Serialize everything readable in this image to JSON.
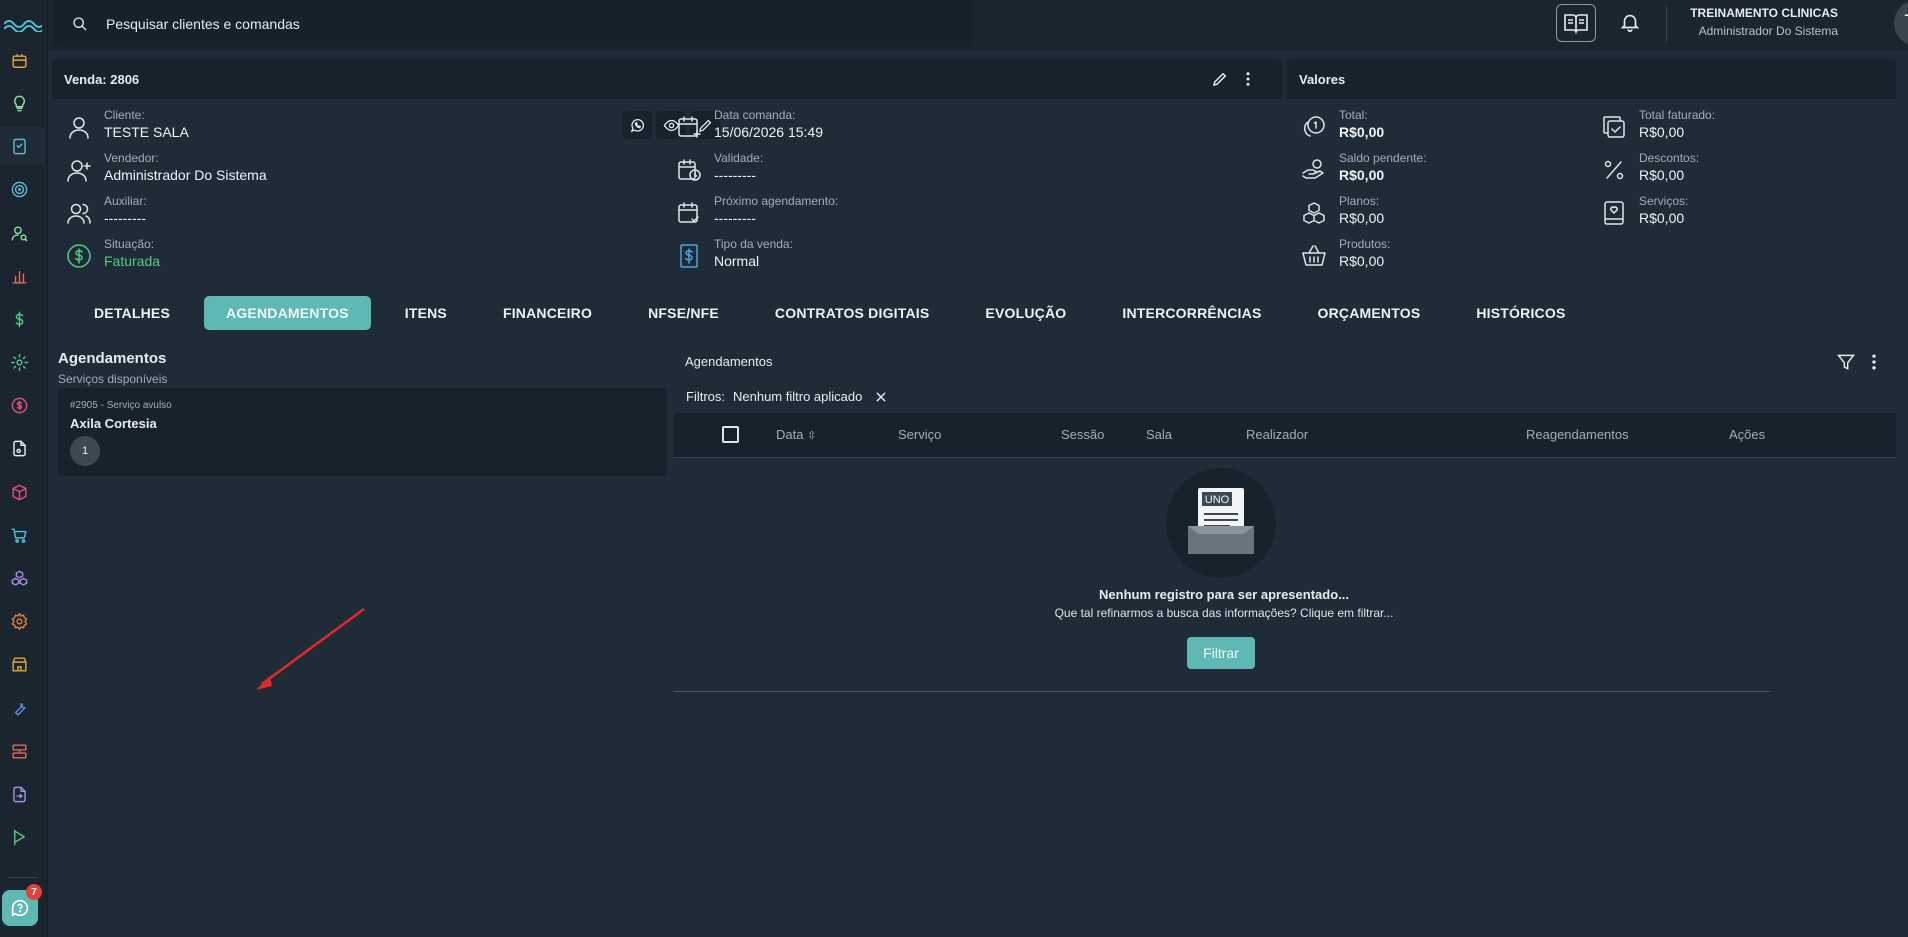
{
  "search": {
    "placeholder": "Pesquisar clientes e comandas"
  },
  "user": {
    "name": "TREINAMENTO CLINICAS",
    "role": "Administrador Do Sistema",
    "initials": "TC"
  },
  "help": {
    "badge": "7"
  },
  "venda": {
    "title": "Venda: 2806",
    "cliente_label": "Cliente:",
    "cliente": "TESTE SALA",
    "vendedor_label": "Vendedor:",
    "vendedor": "Administrador Do Sistema",
    "auxiliar_label": "Auxiliar:",
    "auxiliar": "---------",
    "situacao_label": "Situação:",
    "situacao": "Faturada",
    "data_label": "Data comanda:",
    "data": "15/06/2026 15:49",
    "validade_label": "Validade:",
    "validade": "---------",
    "proximo_label": "Próximo agendamento:",
    "proximo": "---------",
    "tipo_label": "Tipo da venda:",
    "tipo": "Normal"
  },
  "valores": {
    "title": "Valores",
    "total_label": "Total:",
    "total": "R$0,00",
    "saldo_label": "Saldo pendente:",
    "saldo": "R$0,00",
    "planos_label": "Planos:",
    "planos": "R$0,00",
    "produtos_label": "Produtos:",
    "produtos": "R$0,00",
    "faturado_label": "Total faturado:",
    "faturado": "R$0,00",
    "descontos_label": "Descontos:",
    "descontos": "R$0,00",
    "servicos_label": "Serviços:",
    "servicos": "R$0,00"
  },
  "tabs": [
    "DETALHES",
    "AGENDAMENTOS",
    "ITENS",
    "FINANCEIRO",
    "NFSE/NFE",
    "CONTRATOS DIGITAIS",
    "EVOLUÇÃO",
    "INTERCORRÊNCIAS",
    "ORÇAMENTOS",
    "HISTÓRICOS"
  ],
  "agendamentos": {
    "title": "Agendamentos",
    "subtitle": "Serviços disponíveis",
    "service": {
      "code": "#2905 - Serviço avulso",
      "name": "Axila Cortesia",
      "count": "1"
    }
  },
  "table": {
    "title": "Agendamentos",
    "filters_label": "Filtros:",
    "filters_value": "Nenhum filtro aplicado",
    "columns": [
      "Data",
      "Serviço",
      "Sessão",
      "Sala",
      "Realizador",
      "Reagendamentos",
      "Ações"
    ],
    "empty_logo": "UNO",
    "empty_title": "Nenhum registro para ser apresentado...",
    "empty_text": "Que tal refinarmos a busca das informações? Clique em filtrar...",
    "filter_button": "Filtrar"
  },
  "colors": {
    "accent": "#5fb8b3",
    "success": "#52c78c",
    "background": "#1e2a36"
  }
}
